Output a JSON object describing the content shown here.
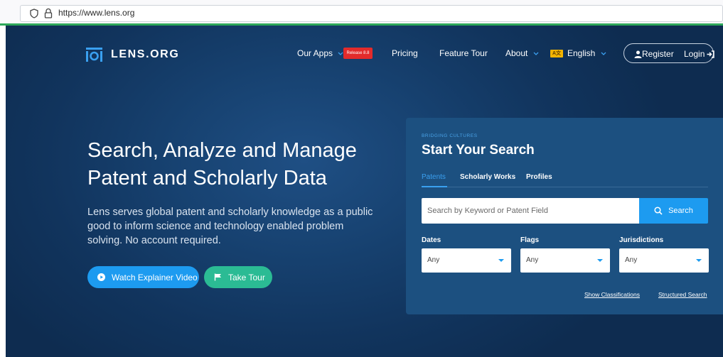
{
  "browser": {
    "url": "https://www.lens.org"
  },
  "nav": {
    "logo_text": "LENS.ORG",
    "our_apps": "Our Apps",
    "release_badge": "Release 8.8",
    "pricing": "Pricing",
    "feature_tour": "Feature Tour",
    "about": "About",
    "language_flag": "A文",
    "language": "English",
    "register": "Register",
    "login": "Login"
  },
  "hero": {
    "headline": "Search, Analyze and Manage Patent and Scholarly Data",
    "subtext": "Lens serves global patent and scholarly knowledge as a public good to inform science and technology enabled problem solving. No account required.",
    "watch_video": "Watch Explainer Video",
    "take_tour": "Take Tour"
  },
  "search": {
    "eyebrow": "BRIDGING CULTURES",
    "title": "Start Your Search",
    "tabs": [
      "Patents",
      "Scholarly Works",
      "Profiles"
    ],
    "placeholder": "Search by Keyword or Patent Field",
    "button": "Search",
    "filters": [
      {
        "label": "Dates",
        "value": "Any"
      },
      {
        "label": "Flags",
        "value": "Any"
      },
      {
        "label": "Jurisdictions",
        "value": "Any"
      }
    ],
    "show_classifications": "Show Classifications",
    "structured_search": "Structured Search"
  },
  "colors": {
    "hero_bg": "#11345d",
    "panel_bg": "#1c5080",
    "accent_blue": "#1d9bf0",
    "accent_green": "#2bbb94",
    "badge_red": "#e32b2b",
    "browser_green": "#2ea85a"
  },
  "icons": [
    "shield-icon",
    "lock-icon",
    "lens-logo-icon",
    "chevron-down-icon",
    "user-icon",
    "login-icon",
    "play-icon",
    "flag-icon",
    "search-icon",
    "caret-down-icon"
  ]
}
